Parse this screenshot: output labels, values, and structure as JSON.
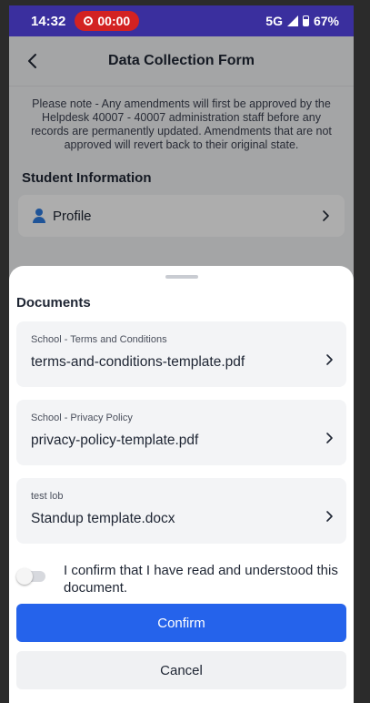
{
  "status_bar": {
    "time": "14:32",
    "recording_timer": "00:00",
    "network": "5G",
    "battery": "67%"
  },
  "header": {
    "title": "Data Collection Form"
  },
  "notice": "Please note - Any amendments will first be approved by the Helpdesk 40007 - 40007 administration staff before any records are permanently updated. Amendments that are not approved will revert back to their original state.",
  "student_information": {
    "title": "Student Information",
    "items": [
      {
        "label": "Profile"
      }
    ]
  },
  "documents_sheet": {
    "title": "Documents",
    "documents": [
      {
        "category": "School - Terms and Conditions",
        "file": "terms-and-conditions-template.pdf"
      },
      {
        "category": "School - Privacy Policy",
        "file": "privacy-policy-template.pdf"
      },
      {
        "category": "test lob",
        "file": "Standup template.docx"
      }
    ],
    "confirm_text": "I confirm that I have read and understood this document.",
    "confirm_checked": false,
    "confirm_button": "Confirm",
    "cancel_button": "Cancel"
  },
  "colors": {
    "status_bar": "#3a2f9e",
    "recording": "#d32222",
    "primary": "#2563eb",
    "profile_icon": "#2f7de0"
  }
}
